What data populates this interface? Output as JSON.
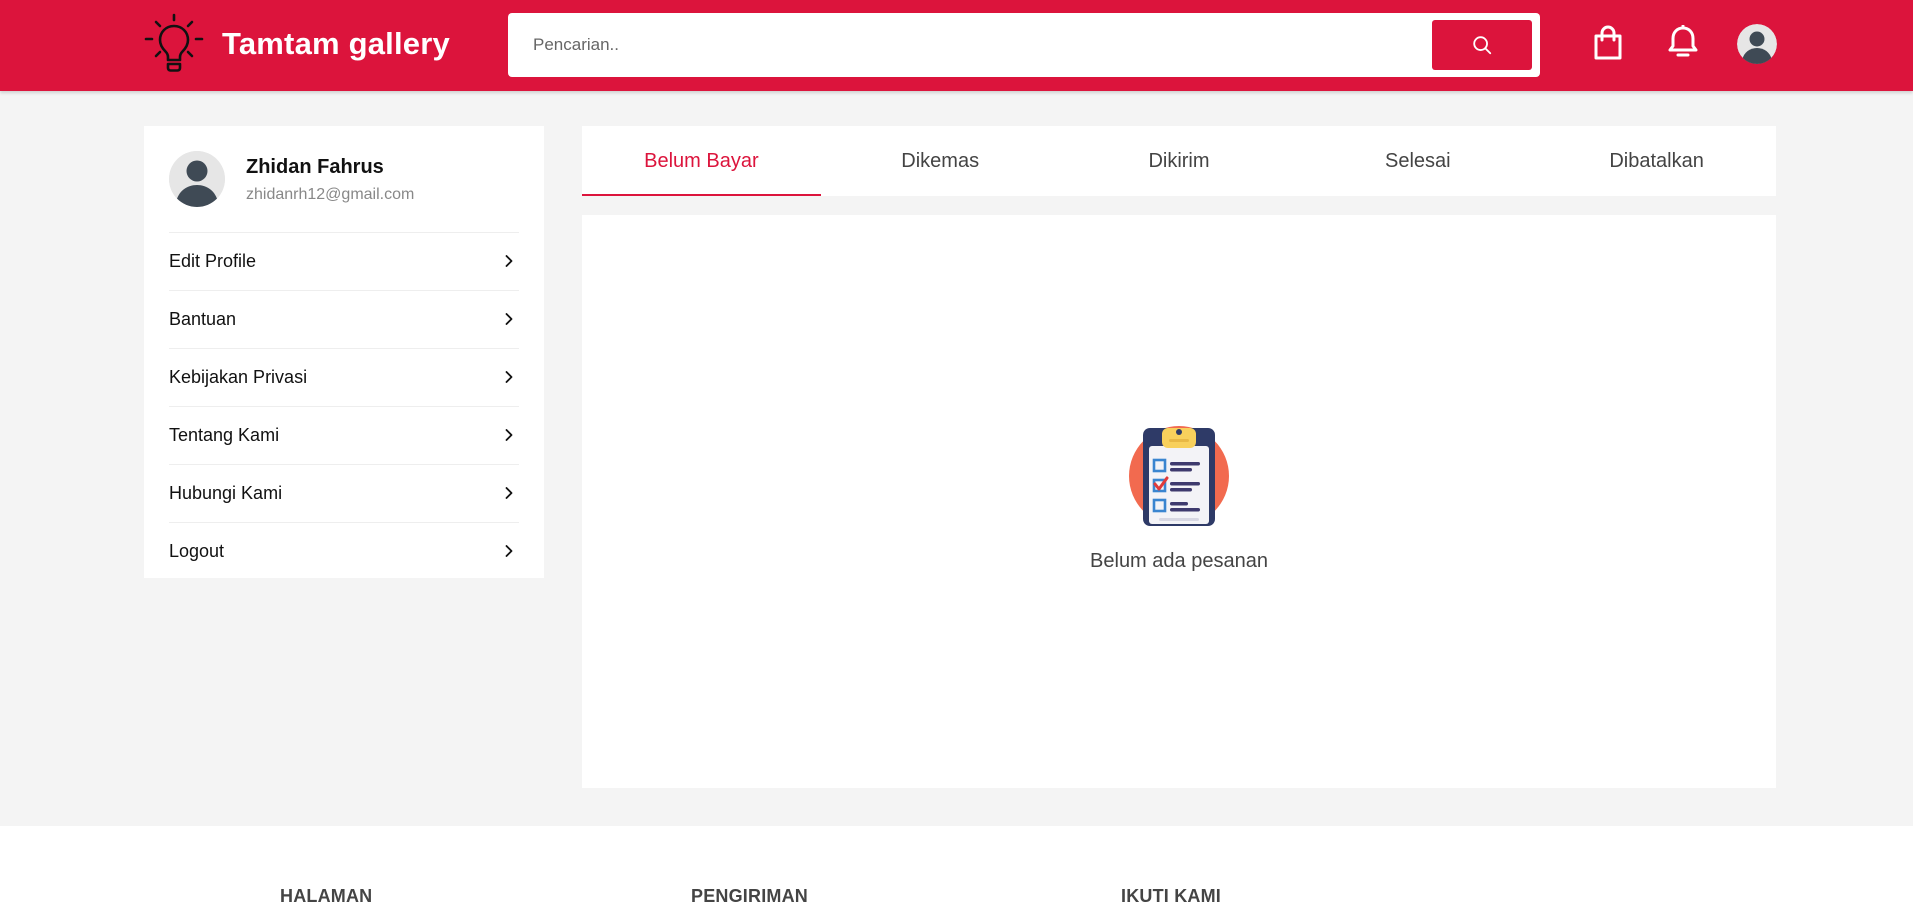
{
  "header": {
    "brand_name": "Tamtam gallery",
    "search_placeholder": "Pencarian..",
    "accent_color": "#dc143c",
    "icons": [
      "lightbulb-icon",
      "search-icon",
      "shopping-bag-icon",
      "bell-icon",
      "user-avatar-icon"
    ]
  },
  "sidebar": {
    "profile": {
      "name": "Zhidan Fahrus",
      "email": "zhidanrh12@gmail.com"
    },
    "items": [
      {
        "label": "Edit Profile"
      },
      {
        "label": "Bantuan"
      },
      {
        "label": "Kebijakan Privasi"
      },
      {
        "label": "Tentang Kami"
      },
      {
        "label": "Hubungi Kami"
      },
      {
        "label": "Logout"
      }
    ]
  },
  "tabs": [
    {
      "label": "Belum Bayar",
      "active": true
    },
    {
      "label": "Dikemas",
      "active": false
    },
    {
      "label": "Dikirim",
      "active": false
    },
    {
      "label": "Selesai",
      "active": false
    },
    {
      "label": "Dibatalkan",
      "active": false
    }
  ],
  "content": {
    "empty_icon": "clipboard-checklist-icon",
    "empty_text": "Belum ada pesanan"
  },
  "footer": {
    "columns": [
      "HALAMAN",
      "PENGIRIMAN",
      "IKUTI KAMI"
    ]
  }
}
